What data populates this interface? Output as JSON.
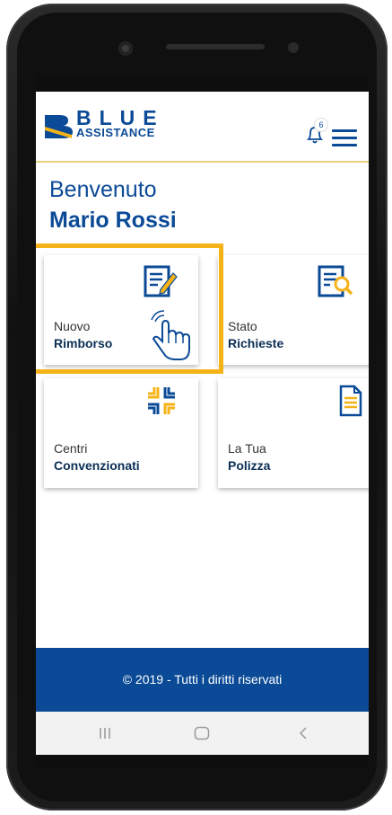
{
  "header": {
    "logo_word": "BLUE",
    "logo_sub": "ASSISTANCE",
    "notification_count": "6"
  },
  "welcome": {
    "greeting": "Benvenuto",
    "user_name": "Mario Rossi"
  },
  "tiles": [
    {
      "line1": "Nuovo",
      "line2": "Rimborso",
      "icon": "edit-document-icon"
    },
    {
      "line1": "Stato",
      "line2": "Richieste",
      "icon": "search-document-icon"
    },
    {
      "line1": "Centri",
      "line2": "Convenzionati",
      "icon": "medical-cross-icon"
    },
    {
      "line1": "La Tua",
      "line2": "Polizza",
      "icon": "policy-document-icon"
    }
  ],
  "footer": {
    "text": "© 2019 - Tutti i diritti riservati"
  },
  "colors": {
    "brand_blue": "#0b4a97",
    "accent_yellow": "#f5b318"
  }
}
